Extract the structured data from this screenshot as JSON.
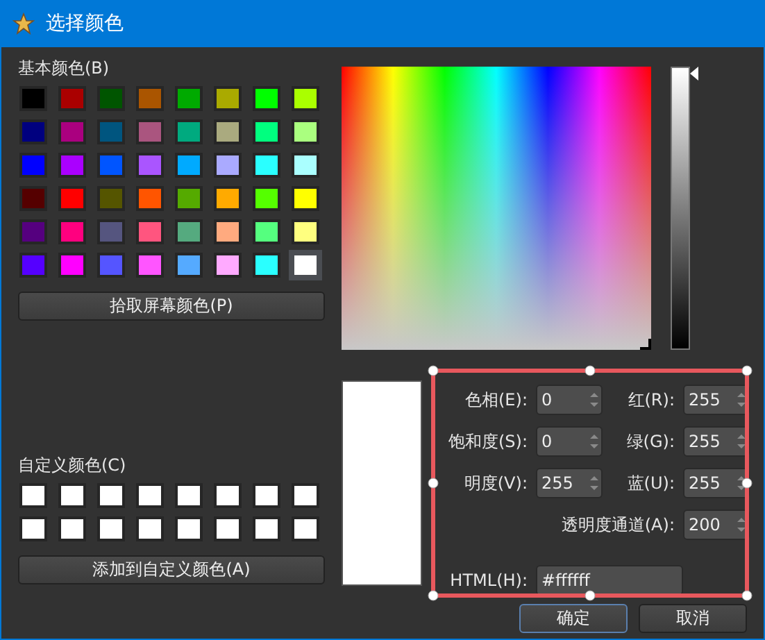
{
  "window": {
    "title": "选择颜色"
  },
  "basic_colors": {
    "label": "基本颜色(B)",
    "swatches": [
      {
        "color": "#000000",
        "selected": false
      },
      {
        "color": "#aa0000",
        "selected": false
      },
      {
        "color": "#005500",
        "selected": false
      },
      {
        "color": "#aa5500",
        "selected": false
      },
      {
        "color": "#00aa00",
        "selected": false
      },
      {
        "color": "#aaaa00",
        "selected": false
      },
      {
        "color": "#00ff00",
        "selected": false
      },
      {
        "color": "#aaff00",
        "selected": false
      },
      {
        "color": "#00007f",
        "selected": false
      },
      {
        "color": "#aa007f",
        "selected": false
      },
      {
        "color": "#00557f",
        "selected": false
      },
      {
        "color": "#aa557f",
        "selected": false
      },
      {
        "color": "#00aa7f",
        "selected": false
      },
      {
        "color": "#aaaa7f",
        "selected": false
      },
      {
        "color": "#00ff7f",
        "selected": false
      },
      {
        "color": "#aaff7f",
        "selected": false
      },
      {
        "color": "#0000ff",
        "selected": false
      },
      {
        "color": "#aa00ff",
        "selected": false
      },
      {
        "color": "#0055ff",
        "selected": false
      },
      {
        "color": "#aa55ff",
        "selected": false
      },
      {
        "color": "#00aaff",
        "selected": false
      },
      {
        "color": "#aaaaff",
        "selected": false
      },
      {
        "color": "#2affff",
        "selected": false
      },
      {
        "color": "#aaffff",
        "selected": false
      },
      {
        "color": "#550000",
        "selected": false
      },
      {
        "color": "#ff0000",
        "selected": false
      },
      {
        "color": "#555500",
        "selected": false
      },
      {
        "color": "#ff5500",
        "selected": false
      },
      {
        "color": "#55aa00",
        "selected": false
      },
      {
        "color": "#ffaa00",
        "selected": false
      },
      {
        "color": "#55ff00",
        "selected": false
      },
      {
        "color": "#ffff00",
        "selected": false
      },
      {
        "color": "#55007f",
        "selected": false
      },
      {
        "color": "#ff007f",
        "selected": false
      },
      {
        "color": "#55557f",
        "selected": false
      },
      {
        "color": "#ff557f",
        "selected": false
      },
      {
        "color": "#55aa7f",
        "selected": false
      },
      {
        "color": "#ffaa7f",
        "selected": false
      },
      {
        "color": "#55ff7f",
        "selected": false
      },
      {
        "color": "#ffff7f",
        "selected": false
      },
      {
        "color": "#5500ff",
        "selected": false
      },
      {
        "color": "#ff00ff",
        "selected": false
      },
      {
        "color": "#5555ff",
        "selected": false
      },
      {
        "color": "#ff55ff",
        "selected": false
      },
      {
        "color": "#55aaff",
        "selected": false
      },
      {
        "color": "#ffaaff",
        "selected": false
      },
      {
        "color": "#2affff",
        "selected": false
      },
      {
        "color": "#ffffff",
        "selected": true
      }
    ]
  },
  "pick_screen_button": "拾取屏幕颜色(P)",
  "custom_colors": {
    "label": "自定义颜色(C)",
    "swatches": [
      {
        "color": "#ffffff"
      },
      {
        "color": "#ffffff"
      },
      {
        "color": "#ffffff"
      },
      {
        "color": "#ffffff"
      },
      {
        "color": "#ffffff"
      },
      {
        "color": "#ffffff"
      },
      {
        "color": "#ffffff"
      },
      {
        "color": "#ffffff"
      },
      {
        "color": "#ffffff"
      },
      {
        "color": "#ffffff"
      },
      {
        "color": "#ffffff"
      },
      {
        "color": "#ffffff"
      },
      {
        "color": "#ffffff"
      },
      {
        "color": "#ffffff"
      },
      {
        "color": "#ffffff"
      },
      {
        "color": "#ffffff"
      }
    ]
  },
  "add_custom_button": "添加到自定义颜色(A)",
  "lightness_slider": {
    "level": 1
  },
  "preview": {
    "color": "#ffffff"
  },
  "fields": [
    {
      "label": "色相(E):",
      "value": "0"
    },
    {
      "label": "红(R):",
      "value": "255"
    },
    {
      "label": "饱和度(S):",
      "value": "0"
    },
    {
      "label": "绿(G):",
      "value": "255"
    },
    {
      "label": "明度(V):",
      "value": "255"
    },
    {
      "label": "蓝(U):",
      "value": "255"
    }
  ],
  "alpha": {
    "label": "透明度通道(A):",
    "value": "200"
  },
  "html": {
    "label": "HTML(H):",
    "value": "#ffffff"
  },
  "buttons": [
    {
      "label": "确定",
      "selected": true
    },
    {
      "label": "取消",
      "selected": false
    }
  ]
}
